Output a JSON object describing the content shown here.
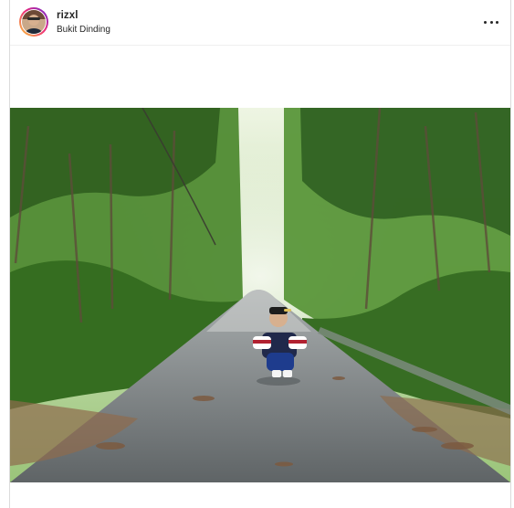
{
  "post": {
    "username": "rizxl",
    "location": "Bukit Dinding",
    "avatar_icon": "user-avatar",
    "more_icon": "more-options-icon",
    "photo_description_icon": "forest-road-photo"
  },
  "colors": {
    "text": "#262626",
    "border": "#dbdbdb",
    "story_ring_start": "#f9ce34",
    "story_ring_mid": "#ee2a7b",
    "story_ring_end": "#6228d7"
  }
}
